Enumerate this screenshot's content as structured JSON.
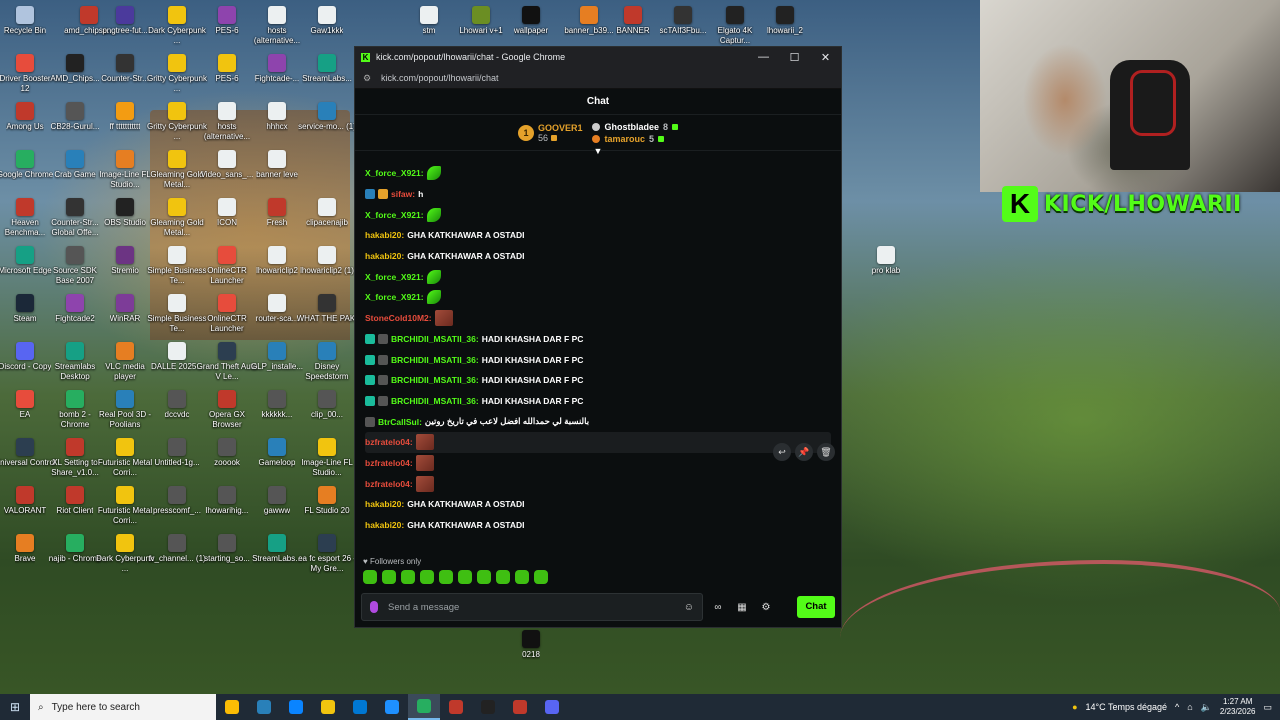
{
  "desktop_icons": [
    {
      "label": "Recycle Bin",
      "color": "#b0c4de"
    },
    {
      "label": "amd_chipse...",
      "color": "#c0392b"
    },
    {
      "label": "pngtree-fut...",
      "color": "#4b3a9c"
    },
    {
      "label": "Dark Cyberpunk ...",
      "color": "#f1c40f"
    },
    {
      "label": "PES-6",
      "color": "#8e44ad"
    },
    {
      "label": "hosts (alternative...",
      "color": "#ecf0f1"
    },
    {
      "label": "Gaw1kkk",
      "color": "#ecf0f1"
    },
    {
      "label": "stm",
      "color": "#ecf0f1"
    },
    {
      "label": "Lhowari v+1",
      "color": "#6b8e23"
    },
    {
      "label": "wallpaper",
      "color": "#111111"
    },
    {
      "label": "banner_b39...",
      "color": "#e67e22"
    },
    {
      "label": "BANNER",
      "color": "#c0392b"
    },
    {
      "label": "scTAIf3Fbu...",
      "color": "#333333"
    },
    {
      "label": "Elgato 4K Captur...",
      "color": "#222222"
    },
    {
      "label": "lhowarii_2",
      "color": "#222222"
    },
    {
      "label": "Driver Booster 12",
      "color": "#e74c3c"
    },
    {
      "label": "AMD_Chips...",
      "color": "#222222"
    },
    {
      "label": "Counter-Str...",
      "color": "#333333"
    },
    {
      "label": "Gritty Cyberpunk ...",
      "color": "#f1c40f"
    },
    {
      "label": "PES-6",
      "color": "#f1c40f"
    },
    {
      "label": "Fightcade-...",
      "color": "#8e44ad"
    },
    {
      "label": "StreamLabs...",
      "color": "#16a085"
    },
    {
      "label": "Among Us",
      "color": "#c0392b"
    },
    {
      "label": "CB28-Gurul...",
      "color": "#555555"
    },
    {
      "label": "ff ttttttttttt",
      "color": "#f39c12"
    },
    {
      "label": "Gritty Cyberpunk ...",
      "color": "#f1c40f"
    },
    {
      "label": "hosts (alternative...",
      "color": "#ecf0f1"
    },
    {
      "label": "hhhcx",
      "color": "#ecf0f1"
    },
    {
      "label": "service-mo... (1)",
      "color": "#2980b9"
    },
    {
      "label": "Google Chrome",
      "color": "#27ae60"
    },
    {
      "label": "Crab Game",
      "color": "#2980b9"
    },
    {
      "label": "Image-Line FL Studio...",
      "color": "#e67e22"
    },
    {
      "label": "Gleaming Gold Metal...",
      "color": "#f1c40f"
    },
    {
      "label": "Video_sans_...",
      "color": "#ecf0f1"
    },
    {
      "label": "banner leve",
      "color": "#ecf0f1"
    },
    {
      "label": "Heaven Benchma...",
      "color": "#c0392b"
    },
    {
      "label": "Counter-Str... Global Offe...",
      "color": "#333333"
    },
    {
      "label": "OBS Studio",
      "color": "#222222"
    },
    {
      "label": "Gleaming Gold Metal...",
      "color": "#f1c40f"
    },
    {
      "label": "ICON",
      "color": "#ecf0f1"
    },
    {
      "label": "Fresh",
      "color": "#c0392b"
    },
    {
      "label": "clipacenajib",
      "color": "#ecf0f1"
    },
    {
      "label": "Microsoft Edge",
      "color": "#16a085"
    },
    {
      "label": "Source SDK Base 2007",
      "color": "#555555"
    },
    {
      "label": "Stremio",
      "color": "#6c3483"
    },
    {
      "label": "Simple Business Te...",
      "color": "#ecf0f1"
    },
    {
      "label": "OnlineCTR Launcher",
      "color": "#e74c3c"
    },
    {
      "label": "lhowariclip2",
      "color": "#ecf0f1"
    },
    {
      "label": "lhowariclip2 (1)",
      "color": "#ecf0f1"
    },
    {
      "label": "Steam",
      "color": "#1b2838"
    },
    {
      "label": "Fightcade2",
      "color": "#8e44ad"
    },
    {
      "label": "WinRAR",
      "color": "#7d3c98"
    },
    {
      "label": "Simple Business Te...",
      "color": "#ecf0f1"
    },
    {
      "label": "OnlineCTR Launcher",
      "color": "#e74c3c"
    },
    {
      "label": "router-sca...",
      "color": "#ecf0f1"
    },
    {
      "label": "WHAT THE PAKI",
      "color": "#333333"
    },
    {
      "label": "Discord - Copy",
      "color": "#5865f2"
    },
    {
      "label": "Streamlabs Desktop",
      "color": "#16a085"
    },
    {
      "label": "VLC media player",
      "color": "#e67e22"
    },
    {
      "label": "DALLE 2025...",
      "color": "#ecf0f1"
    },
    {
      "label": "Grand Theft Auto V Le...",
      "color": "#2c3e50"
    },
    {
      "label": "GLP_installe...",
      "color": "#2980b9"
    },
    {
      "label": "Disney Speedstorm",
      "color": "#2980b9"
    },
    {
      "label": "EA",
      "color": "#e74c3c"
    },
    {
      "label": "bomb 2 - Chrome",
      "color": "#27ae60"
    },
    {
      "label": "Real Pool 3D - Poolians",
      "color": "#2980b9"
    },
    {
      "label": "dccvdc",
      "color": "#555555"
    },
    {
      "label": "Opera GX Browser",
      "color": "#c0392b"
    },
    {
      "label": "kkkkkk...",
      "color": "#555555"
    },
    {
      "label": "clip_00...",
      "color": "#555555"
    },
    {
      "label": "Universal Control",
      "color": "#2c3e50"
    },
    {
      "label": "XL Setting to Share_v1.0...",
      "color": "#c0392b"
    },
    {
      "label": "Futuristic Metal Corri...",
      "color": "#f1c40f"
    },
    {
      "label": "Untitled-1g...",
      "color": "#555555"
    },
    {
      "label": "zooook",
      "color": "#555555"
    },
    {
      "label": "Gameloop",
      "color": "#2980b9"
    },
    {
      "label": "Image-Line FL Studio...",
      "color": "#f1c40f"
    },
    {
      "label": "VALORANT",
      "color": "#c0392b"
    },
    {
      "label": "Riot Client",
      "color": "#c0392b"
    },
    {
      "label": "Futuristic Metal Corri...",
      "color": "#f1c40f"
    },
    {
      "label": "presscomf_...",
      "color": "#555555"
    },
    {
      "label": "lhowarihig...",
      "color": "#555555"
    },
    {
      "label": "gawww",
      "color": "#555555"
    },
    {
      "label": "FL Studio 20",
      "color": "#e67e22"
    },
    {
      "label": "Brave",
      "color": "#e67e22"
    },
    {
      "label": "najib - Chrome",
      "color": "#27ae60"
    },
    {
      "label": "Dark Cyberpunk ...",
      "color": "#f1c40f"
    },
    {
      "label": "tv_channel... (1)",
      "color": "#555555"
    },
    {
      "label": "starting_so...",
      "color": "#555555"
    },
    {
      "label": "StreamLabs...",
      "color": "#16a085"
    },
    {
      "label": "ea fc esport 26 - My Gre...",
      "color": "#2c3e50"
    },
    {
      "label": "pro klab",
      "color": "#ecf0f1"
    },
    {
      "label": "0218",
      "color": "#111111"
    }
  ],
  "window": {
    "title": "kick.com/popout/lhowarii/chat - Google Chrome",
    "url": "kick.com/popout/lhowarii/chat",
    "minimize": "—",
    "maximize": "☐",
    "close": "✕"
  },
  "chat": {
    "header": "Chat",
    "leaderboard": {
      "first": {
        "rank": "1",
        "name": "GOOVER1",
        "points": "56"
      },
      "second": {
        "name": "Ghostbladee",
        "points": "8"
      },
      "third": {
        "name": "tamarouc",
        "points": "5"
      }
    },
    "messages": [
      {
        "user": "X_force_X921",
        "user_color": "#53fc18",
        "text": "",
        "emote": "leaf",
        "badges": []
      },
      {
        "user": "sifaw",
        "user_color": "#e74c3c",
        "text": "h",
        "emote": "",
        "badges": [
          "#2980b9",
          "#e5a22b"
        ]
      },
      {
        "user": "X_force_X921",
        "user_color": "#53fc18",
        "text": "",
        "emote": "leaf",
        "badges": []
      },
      {
        "user": "hakabi20",
        "user_color": "#f1c40f",
        "text": "GHA KATKHAWAR A OSTADI",
        "emote": "",
        "badges": []
      },
      {
        "user": "hakabi20",
        "user_color": "#f1c40f",
        "text": "GHA KATKHAWAR A OSTADI",
        "emote": "",
        "badges": []
      },
      {
        "user": "X_force_X921",
        "user_color": "#53fc18",
        "text": "",
        "emote": "leaf",
        "badges": []
      },
      {
        "user": "X_force_X921",
        "user_color": "#53fc18",
        "text": "",
        "emote": "leaf",
        "badges": []
      },
      {
        "user": "StoneCold10M2",
        "user_color": "#e74c3c",
        "text": "",
        "emote": "cat",
        "badges": []
      },
      {
        "user": "BRCHIDII_MSATII_36",
        "user_color": "#53fc18",
        "text": "HADI KHASHA DAR F PC",
        "emote": "",
        "badges": [
          "#1abc9c",
          "#555555"
        ]
      },
      {
        "user": "BRCHIDII_MSATII_36",
        "user_color": "#53fc18",
        "text": "HADI KHASHA DAR F PC",
        "emote": "",
        "badges": [
          "#1abc9c",
          "#555555"
        ]
      },
      {
        "user": "BRCHIDII_MSATII_36",
        "user_color": "#53fc18",
        "text": "HADI KHASHA DAR F PC",
        "emote": "",
        "badges": [
          "#1abc9c",
          "#555555"
        ]
      },
      {
        "user": "BRCHIDII_MSATII_36",
        "user_color": "#53fc18",
        "text": "HADI KHASHA DAR F PC",
        "emote": "",
        "badges": [
          "#1abc9c",
          "#555555"
        ]
      },
      {
        "user": "BtrCallSul",
        "user_color": "#53fc18",
        "text": "بالنسبة لي حمدالله افضل لاعب في تاريخ روتين",
        "emote": "",
        "badges": [
          "#555555"
        ]
      },
      {
        "user": "bzfratelo04",
        "user_color": "#e74c3c",
        "text": "",
        "emote": "cat",
        "badges": []
      },
      {
        "user": "bzfratelo04",
        "user_color": "#e74c3c",
        "text": "",
        "emote": "cat",
        "badges": []
      },
      {
        "user": "bzfratelo04",
        "user_color": "#e74c3c",
        "text": "",
        "emote": "cat",
        "badges": []
      },
      {
        "user": "hakabi20",
        "user_color": "#f1c40f",
        "text": "GHA KATKHAWAR A OSTADI",
        "emote": "",
        "badges": []
      },
      {
        "user": "hakabi20",
        "user_color": "#f1c40f",
        "text": "GHA KATKHAWAR A OSTADI",
        "emote": "",
        "badges": []
      }
    ],
    "followers_only": "Followers only",
    "placeholder": "Send a message",
    "send_label": "Chat",
    "accent": "#53fc18"
  },
  "overlay": {
    "kick_logo": "K",
    "kick_text": "KICK/LHOWARII"
  },
  "taskbar": {
    "search_placeholder": "Type here to search",
    "weather": "14°C  Temps dégagé",
    "time": "1:27 AM",
    "date": "2/23/2026",
    "apps": [
      "#fbbc05",
      "#2980b9",
      "#0a84ff",
      "#f1c40f",
      "#0078d4",
      "#1e90ff",
      "#27ae60",
      "#c0392b",
      "#222222",
      "#c0392b",
      "#5865f2"
    ]
  }
}
